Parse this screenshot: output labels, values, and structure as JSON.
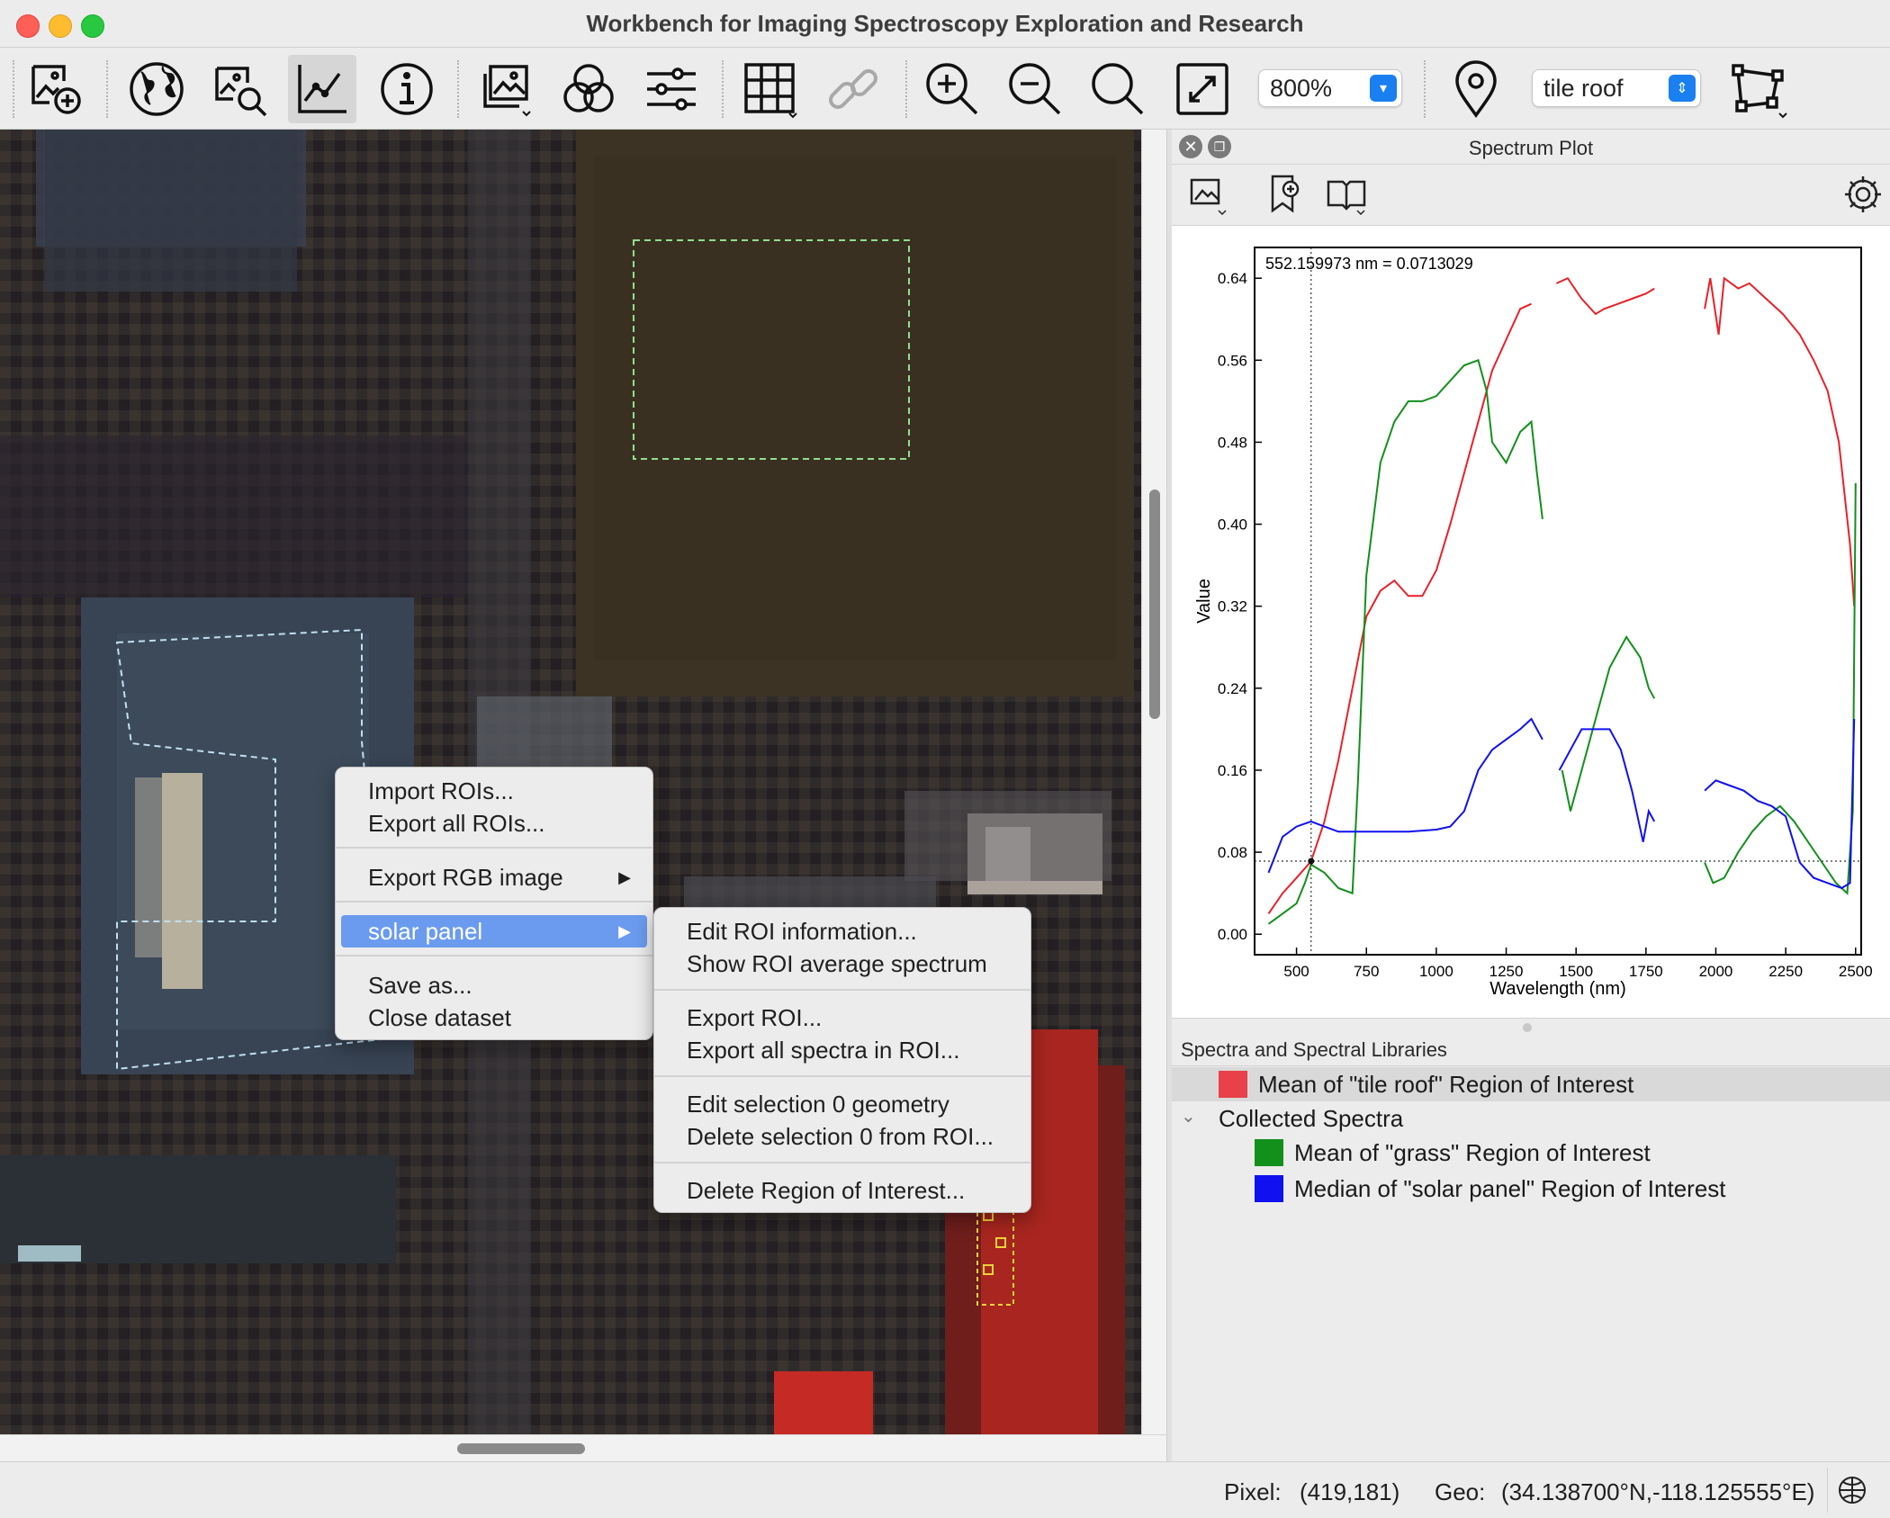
{
  "window": {
    "title": "Workbench for Imaging Spectroscopy Exploration and Research"
  },
  "toolbar": {
    "zoom_value": "800%",
    "roi_value": "tile roof",
    "buttons": [
      "open-image",
      "basemap",
      "image-search",
      "spectrum-plot",
      "info",
      "raster-view",
      "color-composite",
      "adjust-stretch",
      "grid-layout",
      "link-views",
      "zoom-in",
      "zoom-out",
      "zoom-fit",
      "fullscreen",
      "pin",
      "roi-edit"
    ]
  },
  "context_menu": {
    "items": [
      {
        "label": "Import ROIs...",
        "submenu": false
      },
      {
        "label": "Export all ROIs...",
        "submenu": false
      },
      {
        "label": "Export RGB image",
        "submenu": true
      },
      {
        "label": "solar panel",
        "submenu": true,
        "selected": true
      },
      {
        "label": "Save as...",
        "submenu": false
      },
      {
        "label": "Close dataset",
        "submenu": false
      }
    ]
  },
  "submenu": {
    "items": [
      "Edit ROI information...",
      "Show ROI average spectrum",
      "Export ROI...",
      "Export all spectra in ROI...",
      "Edit selection 0 geometry",
      "Delete selection 0 from ROI...",
      "Delete Region of Interest..."
    ]
  },
  "spectrum_panel": {
    "title": "Spectrum Plot",
    "cursor_readout": "552.159973 nm = 0.0713029"
  },
  "chart_data": {
    "type": "line",
    "xlabel": "Wavelength (nm)",
    "ylabel": "Value",
    "xlim": [
      350,
      2520
    ],
    "ylim": [
      -0.02,
      0.67
    ],
    "xticks": [
      500,
      750,
      1000,
      1250,
      1500,
      1750,
      2000,
      2250,
      2500
    ],
    "xtick_labels": [
      "500",
      "750",
      "1000",
      "1250",
      "1500",
      "1750",
      "2000",
      "2250",
      "2500"
    ],
    "yticks": [
      0.0,
      0.08,
      0.16,
      0.24,
      0.32,
      0.4,
      0.48,
      0.56,
      0.64
    ],
    "ytick_labels": [
      "0.00",
      "0.08",
      "0.16",
      "0.24",
      "0.32",
      "0.40",
      "0.48",
      "0.56",
      "0.64"
    ],
    "cursor": {
      "x": 552.159973,
      "y": 0.0713029
    },
    "series": [
      {
        "name": "Mean of \"tile roof\" Region of Interest",
        "color": "#e8212a",
        "segments": [
          [
            [
              400,
              0.02
            ],
            [
              450,
              0.04
            ],
            [
              500,
              0.055
            ],
            [
              552,
              0.071
            ],
            [
              600,
              0.11
            ],
            [
              650,
              0.17
            ],
            [
              700,
              0.24
            ],
            [
              750,
              0.31
            ],
            [
              800,
              0.335
            ],
            [
              850,
              0.345
            ],
            [
              900,
              0.33
            ],
            [
              950,
              0.33
            ],
            [
              1000,
              0.355
            ],
            [
              1050,
              0.4
            ],
            [
              1100,
              0.45
            ],
            [
              1150,
              0.5
            ],
            [
              1200,
              0.55
            ],
            [
              1250,
              0.58
            ],
            [
              1300,
              0.61
            ],
            [
              1340,
              0.615
            ]
          ],
          [
            [
              1430,
              0.635
            ],
            [
              1470,
              0.64
            ],
            [
              1520,
              0.62
            ],
            [
              1570,
              0.605
            ],
            [
              1600,
              0.61
            ],
            [
              1650,
              0.615
            ],
            [
              1700,
              0.62
            ],
            [
              1750,
              0.625
            ],
            [
              1780,
              0.63
            ]
          ],
          [
            [
              1960,
              0.61
            ],
            [
              1980,
              0.64
            ],
            [
              2010,
              0.585
            ],
            [
              2030,
              0.64
            ],
            [
              2080,
              0.63
            ],
            [
              2120,
              0.635
            ],
            [
              2180,
              0.62
            ],
            [
              2240,
              0.605
            ],
            [
              2300,
              0.585
            ],
            [
              2350,
              0.56
            ],
            [
              2400,
              0.53
            ],
            [
              2440,
              0.48
            ],
            [
              2460,
              0.43
            ],
            [
              2480,
              0.38
            ],
            [
              2495,
              0.32
            ]
          ]
        ]
      },
      {
        "name": "Mean of \"grass\" Region of Interest",
        "color": "#138f1c",
        "segments": [
          [
            [
              400,
              0.01
            ],
            [
              450,
              0.02
            ],
            [
              500,
              0.03
            ],
            [
              530,
              0.05
            ],
            [
              552,
              0.068
            ],
            [
              600,
              0.06
            ],
            [
              650,
              0.045
            ],
            [
              700,
              0.04
            ],
            [
              720,
              0.15
            ],
            [
              750,
              0.35
            ],
            [
              800,
              0.46
            ],
            [
              850,
              0.5
            ],
            [
              900,
              0.52
            ],
            [
              950,
              0.52
            ],
            [
              1000,
              0.525
            ],
            [
              1050,
              0.54
            ],
            [
              1100,
              0.555
            ],
            [
              1150,
              0.56
            ],
            [
              1180,
              0.53
            ],
            [
              1200,
              0.48
            ],
            [
              1250,
              0.46
            ],
            [
              1300,
              0.49
            ],
            [
              1340,
              0.5
            ],
            [
              1360,
              0.45
            ],
            [
              1380,
              0.405
            ]
          ],
          [
            [
              1450,
              0.16
            ],
            [
              1480,
              0.12
            ],
            [
              1520,
              0.16
            ],
            [
              1570,
              0.21
            ],
            [
              1620,
              0.26
            ],
            [
              1680,
              0.29
            ],
            [
              1730,
              0.27
            ],
            [
              1760,
              0.24
            ],
            [
              1780,
              0.23
            ]
          ],
          [
            [
              1960,
              0.07
            ],
            [
              1990,
              0.05
            ],
            [
              2030,
              0.055
            ],
            [
              2080,
              0.08
            ],
            [
              2130,
              0.1
            ],
            [
              2180,
              0.115
            ],
            [
              2230,
              0.125
            ],
            [
              2280,
              0.11
            ],
            [
              2330,
              0.09
            ],
            [
              2380,
              0.07
            ],
            [
              2430,
              0.05
            ],
            [
              2470,
              0.04
            ],
            [
              2490,
              0.12
            ],
            [
              2500,
              0.44
            ]
          ]
        ]
      },
      {
        "name": "Median of \"solar panel\" Region of Interest",
        "color": "#1010f0",
        "segments": [
          [
            [
              400,
              0.06
            ],
            [
              450,
              0.095
            ],
            [
              500,
              0.105
            ],
            [
              552,
              0.11
            ],
            [
              600,
              0.105
            ],
            [
              650,
              0.1
            ],
            [
              700,
              0.1
            ],
            [
              800,
              0.1
            ],
            [
              900,
              0.1
            ],
            [
              1000,
              0.102
            ],
            [
              1050,
              0.105
            ],
            [
              1100,
              0.12
            ],
            [
              1150,
              0.16
            ],
            [
              1200,
              0.18
            ],
            [
              1250,
              0.19
            ],
            [
              1300,
              0.2
            ],
            [
              1340,
              0.21
            ],
            [
              1380,
              0.19
            ]
          ],
          [
            [
              1440,
              0.16
            ],
            [
              1480,
              0.18
            ],
            [
              1520,
              0.2
            ],
            [
              1570,
              0.2
            ],
            [
              1620,
              0.2
            ],
            [
              1660,
              0.18
            ],
            [
              1700,
              0.14
            ],
            [
              1740,
              0.09
            ],
            [
              1760,
              0.12
            ],
            [
              1780,
              0.11
            ]
          ],
          [
            [
              1960,
              0.14
            ],
            [
              2000,
              0.15
            ],
            [
              2050,
              0.145
            ],
            [
              2100,
              0.14
            ],
            [
              2150,
              0.13
            ],
            [
              2200,
              0.125
            ],
            [
              2250,
              0.115
            ],
            [
              2300,
              0.07
            ],
            [
              2350,
              0.055
            ],
            [
              2400,
              0.05
            ],
            [
              2450,
              0.045
            ],
            [
              2480,
              0.05
            ],
            [
              2495,
              0.21
            ]
          ]
        ]
      }
    ]
  },
  "library": {
    "header": "Spectra and Spectral Libraries",
    "top_item": {
      "label": "Mean of \"tile roof\" Region of Interest",
      "color": "#e8414a"
    },
    "group_label": "Collected Spectra",
    "items": [
      {
        "label": "Mean of \"grass\" Region of Interest",
        "color": "#138f1c"
      },
      {
        "label": "Median of \"solar panel\" Region of Interest",
        "color": "#1010f0"
      }
    ]
  },
  "status": {
    "pixel_label": "Pixel:",
    "pixel_value": "(419,181)",
    "geo_label": "Geo:",
    "geo_value": "(34.138700°N,-118.125555°E)"
  }
}
